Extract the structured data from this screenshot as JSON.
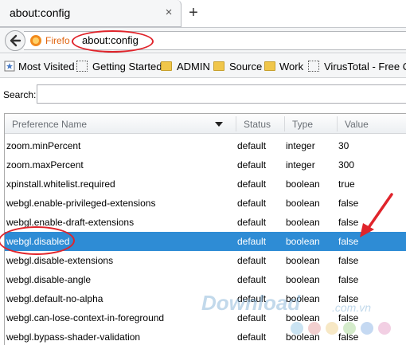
{
  "tab": {
    "title": "about:config",
    "close_symbol": "×",
    "new_tab_symbol": "+"
  },
  "urlbar": {
    "identity_label": "Firefo",
    "url": "about:config"
  },
  "bookmarks": [
    {
      "label": "Most Visited",
      "icon": "bookmark-star-icon"
    },
    {
      "label": "Getting Started",
      "icon": "dotted-page-icon"
    },
    {
      "label": "ADMIN",
      "icon": "folder-icon"
    },
    {
      "label": "Source",
      "icon": "folder-icon"
    },
    {
      "label": "Work",
      "icon": "folder-icon"
    },
    {
      "label": "VirusTotal - Free On",
      "icon": "dotted-page-icon"
    }
  ],
  "search": {
    "label": "Search:",
    "value": ""
  },
  "table": {
    "headers": {
      "name": "Preference Name",
      "status": "Status",
      "type": "Type",
      "value": "Value"
    },
    "rows": [
      {
        "name": "zoom.minPercent",
        "status": "default",
        "type": "integer",
        "value": "30"
      },
      {
        "name": "zoom.maxPercent",
        "status": "default",
        "type": "integer",
        "value": "300"
      },
      {
        "name": "xpinstall.whitelist.required",
        "status": "default",
        "type": "boolean",
        "value": "true"
      },
      {
        "name": "webgl.enable-privileged-extensions",
        "status": "default",
        "type": "boolean",
        "value": "false"
      },
      {
        "name": "webgl.enable-draft-extensions",
        "status": "default",
        "type": "boolean",
        "value": "false"
      },
      {
        "name": "webgl.disabled",
        "status": "default",
        "type": "boolean",
        "value": "false",
        "selected": true
      },
      {
        "name": "webgl.disable-extensions",
        "status": "default",
        "type": "boolean",
        "value": "false"
      },
      {
        "name": "webgl.disable-angle",
        "status": "default",
        "type": "boolean",
        "value": "false"
      },
      {
        "name": "webgl.default-no-alpha",
        "status": "default",
        "type": "boolean",
        "value": "false"
      },
      {
        "name": "webgl.can-lose-context-in-foreground",
        "status": "default",
        "type": "boolean",
        "value": "false"
      },
      {
        "name": "webgl.bypass-shader-validation",
        "status": "default",
        "type": "boolean",
        "value": "false"
      }
    ]
  },
  "watermark": {
    "main": "Download",
    "sub": ".com.vn"
  },
  "colors": {
    "selection": "#2e8cd5",
    "annotation_red": "#e0242b",
    "firefox_orange": "#e06510"
  }
}
